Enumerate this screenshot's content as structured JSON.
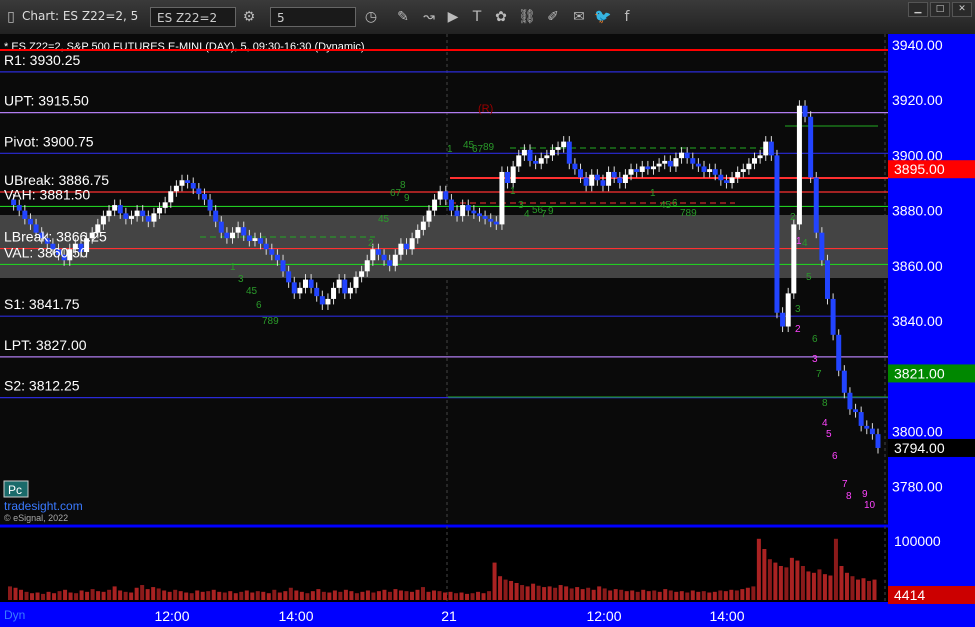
{
  "toolbar": {
    "title": "Chart: ES Z22=2, 5",
    "symbol_input": "ES Z22=2",
    "interval_input": "5",
    "icons": [
      "gear-icon",
      "clock-icon",
      "pencil-icon",
      "draw-curve-icon",
      "play-icon",
      "text-tool-icon",
      "settings-cog-icon",
      "link-icon",
      "comment-icon",
      "twitter-icon",
      "facebook-icon"
    ]
  },
  "window_controls": [
    "minimize",
    "maximize",
    "close"
  ],
  "chart": {
    "header": "* ES Z22=2, S&P 500 FUTURES E-MINI (DAY), 5, 09:30-16:30 (Dynamic)",
    "tradesight_label": "tradesight.com",
    "copyright": "© eSignal, 2022",
    "pc_button": "Pc",
    "r_marker": "(R)",
    "dyn_label": "Dyn",
    "levels": [
      {
        "label": "R1: 3930.25",
        "price": 3930.25,
        "color": "#2a2ad8"
      },
      {
        "label": "UPT: 3915.50",
        "price": 3915.5,
        "color": "#b07cf0"
      },
      {
        "label": "Pivot: 3900.75",
        "price": 3900.75,
        "color": "#2a2ad8"
      },
      {
        "label": "UBreak: 3886.75",
        "price": 3886.75,
        "color": "#ff3030"
      },
      {
        "label": "VAH: 3881.50",
        "price": 3881.5,
        "color": "#22cc22"
      },
      {
        "label": "LBreak: 3866.25",
        "price": 3866.25,
        "color": "#ff3030"
      },
      {
        "label": "VAL: 3860.50",
        "price": 3860.5,
        "color": "#22cc22"
      },
      {
        "label": "S1: 3841.75",
        "price": 3841.75,
        "color": "#2a2ad8"
      },
      {
        "label": "LPT: 3827.00",
        "price": 3827.0,
        "color": "#b07cf0"
      },
      {
        "label": "S2: 3812.25",
        "price": 3812.25,
        "color": "#2a2ad8"
      }
    ],
    "price_axis": [
      "3940.00",
      "3920.00",
      "3900.00",
      "3880.00",
      "3860.00",
      "3840.00",
      "3820.00",
      "3800.00",
      "3780.00"
    ],
    "price_tags": [
      {
        "text": "3895.00",
        "bg": "#ff0000"
      },
      {
        "text": "3821.00",
        "bg": "#008800"
      },
      {
        "text": "3794.00",
        "bg": "#000000"
      }
    ],
    "volume_axis": "100000",
    "volume_tag": "4414",
    "time_axis": [
      "12:00",
      "14:00",
      "21",
      "12:00",
      "14:00"
    ],
    "candles": [
      3884,
      3882,
      3880,
      3877,
      3875,
      3872,
      3870,
      3868,
      3866,
      3864,
      3862,
      3866,
      3868,
      3865,
      3870,
      3872,
      3875,
      3878,
      3880,
      3882,
      3879,
      3877,
      3878,
      3880,
      3878,
      3876,
      3879,
      3881,
      3883,
      3887,
      3889,
      3891,
      3890,
      3888,
      3886,
      3884,
      3880,
      3876,
      3872,
      3870,
      3872,
      3874,
      3871,
      3869,
      3870,
      3868,
      3866,
      3864,
      3862,
      3858,
      3854,
      3850,
      3852,
      3855,
      3852,
      3849,
      3846,
      3848,
      3852,
      3855,
      3850,
      3852,
      3856,
      3858,
      3862,
      3866,
      3864,
      3862,
      3860,
      3864,
      3868,
      3866,
      3870,
      3873,
      3876,
      3880,
      3884,
      3887,
      3884,
      3880,
      3878,
      3882,
      3880,
      3879,
      3878,
      3877,
      3876,
      3875,
      3894,
      3890,
      3896,
      3900,
      3902,
      3898,
      3897,
      3899,
      3900,
      3902,
      3903,
      3905,
      3897,
      3895,
      3892,
      3889,
      3893,
      3891,
      3889,
      3894,
      3892,
      3890,
      3893,
      3895,
      3894,
      3896,
      3895,
      3896,
      3897,
      3898,
      3896,
      3899,
      3901,
      3899,
      3897,
      3896,
      3894,
      3895,
      3893,
      3891,
      3890,
      3892,
      3894,
      3895,
      3897,
      3899,
      3900,
      3905,
      3900,
      3843,
      3838,
      3850,
      3875,
      3918,
      3914,
      3892,
      3872,
      3862,
      3848,
      3835,
      3822,
      3814,
      3808,
      3807,
      3802,
      3801,
      3799,
      3794
    ],
    "volume_bars": [
      0.2,
      0.18,
      0.15,
      0.12,
      0.1,
      0.11,
      0.09,
      0.12,
      0.1,
      0.13,
      0.15,
      0.11,
      0.1,
      0.14,
      0.12,
      0.16,
      0.13,
      0.12,
      0.15,
      0.2,
      0.14,
      0.12,
      0.11,
      0.18,
      0.22,
      0.16,
      0.19,
      0.17,
      0.14,
      0.12,
      0.15,
      0.13,
      0.11,
      0.1,
      0.14,
      0.12,
      0.13,
      0.15,
      0.12,
      0.11,
      0.13,
      0.1,
      0.12,
      0.14,
      0.11,
      0.13,
      0.12,
      0.1,
      0.15,
      0.11,
      0.13,
      0.18,
      0.14,
      0.12,
      0.1,
      0.13,
      0.16,
      0.12,
      0.11,
      0.14,
      0.12,
      0.15,
      0.13,
      0.1,
      0.12,
      0.14,
      0.11,
      0.13,
      0.15,
      0.12,
      0.16,
      0.14,
      0.13,
      0.12,
      0.15,
      0.19,
      0.12,
      0.14,
      0.13,
      0.11,
      0.12,
      0.1,
      0.11,
      0.09,
      0.1,
      0.12,
      0.1,
      0.13,
      0.55,
      0.35,
      0.3,
      0.28,
      0.25,
      0.22,
      0.2,
      0.24,
      0.21,
      0.19,
      0.2,
      0.18,
      0.22,
      0.2,
      0.17,
      0.19,
      0.16,
      0.18,
      0.15,
      0.2,
      0.17,
      0.14,
      0.16,
      0.15,
      0.13,
      0.14,
      0.12,
      0.15,
      0.13,
      0.14,
      0.12,
      0.16,
      0.14,
      0.12,
      0.13,
      0.11,
      0.14,
      0.12,
      0.13,
      0.11,
      0.12,
      0.14,
      0.13,
      0.15,
      0.14,
      0.16,
      0.18,
      0.2,
      0.9,
      0.75,
      0.6,
      0.55,
      0.5,
      0.48,
      0.62,
      0.58,
      0.5,
      0.42,
      0.4,
      0.45,
      0.38,
      0.36,
      0.9,
      0.5,
      0.4,
      0.35,
      0.3,
      0.32,
      0.28,
      0.3
    ]
  }
}
